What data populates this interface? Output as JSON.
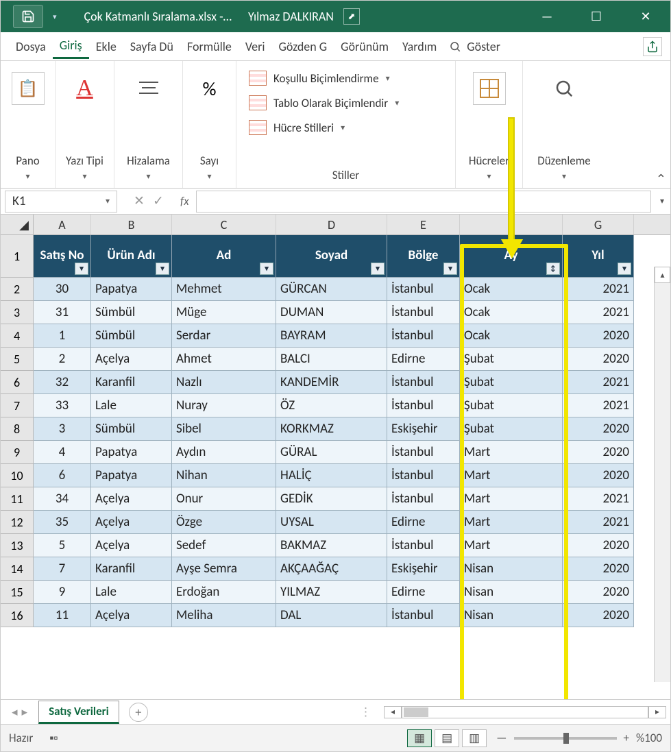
{
  "title_bar": {
    "filename": "Çok Katmanlı Sıralama.xlsx  -…",
    "user": "Yılmaz DALKIRAN"
  },
  "ribbon_tabs": {
    "file": "Dosya",
    "home": "Giriş",
    "insert": "Ekle",
    "page_layout": "Sayfa Dü",
    "formulas": "Formülle",
    "data": "Veri",
    "review": "Gözden G",
    "view": "Görünüm",
    "help": "Yardım",
    "search": "Göster"
  },
  "ribbon_groups": {
    "clipboard": "Pano",
    "font": "Yazı Tipi",
    "alignment": "Hizalama",
    "number": "Sayı",
    "styles_label": "Stiller",
    "cond_format": "Koşullu Biçimlendirme",
    "format_table": "Tablo Olarak Biçimlendir",
    "cell_styles": "Hücre Stilleri",
    "cells": "Hücreler",
    "editing": "Düzenleme"
  },
  "formula_bar": {
    "name_box": "K1",
    "fx": "fx",
    "value": ""
  },
  "columns": [
    "A",
    "B",
    "C",
    "D",
    "E",
    "F",
    "G"
  ],
  "table_headers": {
    "a": "Satış No",
    "b": "Ürün Adı",
    "c": "Ad",
    "d": "Soyad",
    "e": "Bölge",
    "f": "Ay",
    "g": "Yıl"
  },
  "rows": [
    {
      "n": 2,
      "a": "30",
      "b": "Papatya",
      "c": "Mehmet",
      "d": "GÜRCAN",
      "e": "İstanbul",
      "f": "Ocak",
      "g": "2021"
    },
    {
      "n": 3,
      "a": "31",
      "b": "Sümbül",
      "c": "Müge",
      "d": "DUMAN",
      "e": "İstanbul",
      "f": "Ocak",
      "g": "2021"
    },
    {
      "n": 4,
      "a": "1",
      "b": "Sümbül",
      "c": "Serdar",
      "d": "BAYRAM",
      "e": "İstanbul",
      "f": "Ocak",
      "g": "2020"
    },
    {
      "n": 5,
      "a": "2",
      "b": "Açelya",
      "c": "Ahmet",
      "d": "BALCI",
      "e": "Edirne",
      "f": "Şubat",
      "g": "2020"
    },
    {
      "n": 6,
      "a": "32",
      "b": "Karanfil",
      "c": "Nazlı",
      "d": "KANDEMİR",
      "e": "İstanbul",
      "f": "Şubat",
      "g": "2021"
    },
    {
      "n": 7,
      "a": "33",
      "b": "Lale",
      "c": "Nuray",
      "d": "ÖZ",
      "e": "İstanbul",
      "f": "Şubat",
      "g": "2021"
    },
    {
      "n": 8,
      "a": "3",
      "b": "Sümbül",
      "c": "Sibel",
      "d": "KORKMAZ",
      "e": "Eskişehir",
      "f": "Şubat",
      "g": "2020"
    },
    {
      "n": 9,
      "a": "4",
      "b": "Papatya",
      "c": "Aydın",
      "d": "GÜRAL",
      "e": "İstanbul",
      "f": "Mart",
      "g": "2020"
    },
    {
      "n": 10,
      "a": "6",
      "b": "Papatya",
      "c": "Nihan",
      "d": "HALİÇ",
      "e": "İstanbul",
      "f": "Mart",
      "g": "2020"
    },
    {
      "n": 11,
      "a": "34",
      "b": "Açelya",
      "c": "Onur",
      "d": "GEDİK",
      "e": "İstanbul",
      "f": "Mart",
      "g": "2021"
    },
    {
      "n": 12,
      "a": "35",
      "b": "Açelya",
      "c": "Özge",
      "d": "UYSAL",
      "e": "Edirne",
      "f": "Mart",
      "g": "2021"
    },
    {
      "n": 13,
      "a": "5",
      "b": "Açelya",
      "c": "Sedef",
      "d": "BAKMAZ",
      "e": "İstanbul",
      "f": "Mart",
      "g": "2020"
    },
    {
      "n": 14,
      "a": "7",
      "b": "Karanfil",
      "c": "Ayşe Semra",
      "d": "AKÇAAĞAÇ",
      "e": "Eskişehir",
      "f": "Nisan",
      "g": "2020"
    },
    {
      "n": 15,
      "a": "9",
      "b": "Lale",
      "c": "Erdoğan",
      "d": "YILMAZ",
      "e": "Edirne",
      "f": "Nisan",
      "g": "2020"
    },
    {
      "n": 16,
      "a": "11",
      "b": "Açelya",
      "c": "Meliha",
      "d": "DAL",
      "e": "İstanbul",
      "f": "Nisan",
      "g": "2020"
    }
  ],
  "sheet_tab": "Satış Verileri",
  "status": {
    "ready": "Hazır",
    "zoom": "%100"
  }
}
